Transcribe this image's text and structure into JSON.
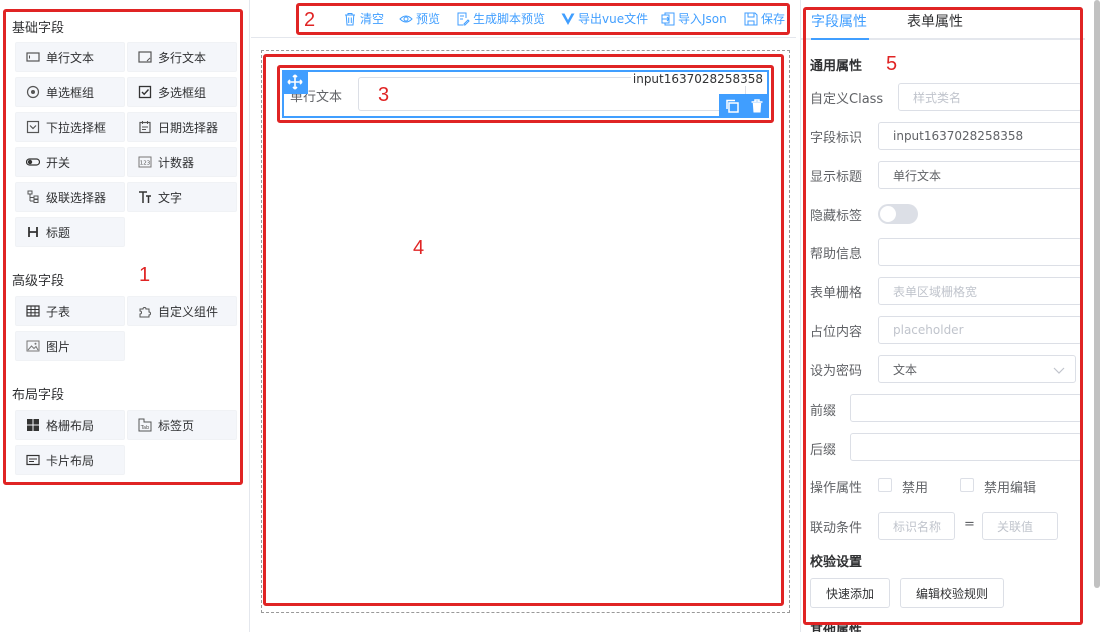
{
  "palette": {
    "basic_title": "基础字段",
    "basic_items": [
      {
        "label": "单行文本",
        "icon": "input-icon"
      },
      {
        "label": "多行文本",
        "icon": "textarea-icon"
      },
      {
        "label": "单选框组",
        "icon": "radio-icon"
      },
      {
        "label": "多选框组",
        "icon": "checkbox-icon"
      },
      {
        "label": "下拉选择框",
        "icon": "select-icon"
      },
      {
        "label": "日期选择器",
        "icon": "calendar-icon"
      },
      {
        "label": "开关",
        "icon": "switch-icon"
      },
      {
        "label": "计数器",
        "icon": "counter-icon"
      },
      {
        "label": "级联选择器",
        "icon": "cascader-icon"
      },
      {
        "label": "文字",
        "icon": "text-icon"
      },
      {
        "label": "标题",
        "icon": "heading-icon"
      }
    ],
    "advanced_title": "高级字段",
    "advanced_items": [
      {
        "label": "子表",
        "icon": "table-icon"
      },
      {
        "label": "自定义组件",
        "icon": "puzzle-icon"
      },
      {
        "label": "图片",
        "icon": "image-icon"
      }
    ],
    "layout_title": "布局字段",
    "layout_items": [
      {
        "label": "格栅布局",
        "icon": "grid-icon"
      },
      {
        "label": "标签页",
        "icon": "tabs-icon"
      },
      {
        "label": "卡片布局",
        "icon": "card-icon"
      }
    ]
  },
  "toolbar": {
    "clear": "清空",
    "preview": "预览",
    "script_preview": "生成脚本预览",
    "export_vue": "导出vue文件",
    "import_json": "导入Json",
    "save": "保存"
  },
  "canvas": {
    "field_label": "单行文本",
    "field_id": "input1637028258358"
  },
  "panel": {
    "tab_field": "字段属性",
    "tab_form": "表单属性",
    "common_title": "通用属性",
    "custom_class_label": "自定义Class",
    "custom_class_placeholder": "样式类名",
    "field_id_label": "字段标识",
    "field_id_value": "input1637028258358",
    "display_title_label": "显示标题",
    "display_title_value": "单行文本",
    "hide_label_label": "隐藏标签",
    "help_label": "帮助信息",
    "grid_label": "表单栅格",
    "grid_placeholder": "表单区域栅格宽",
    "placeholder_label": "占位内容",
    "placeholder_placeholder": "placeholder",
    "password_label": "设为密码",
    "password_value": "文本",
    "prefix_label": "前缀",
    "suffix_label": "后缀",
    "ops_label": "操作属性",
    "disable_label": "禁用",
    "disable_edit_label": "禁用编辑",
    "link_label": "联动条件",
    "link_key_placeholder": "标识名称",
    "link_eq": "=",
    "link_val_placeholder": "关联值",
    "validate_title": "校验设置",
    "quick_add": "快速添加",
    "edit_rules": "编辑校验规则",
    "other_title": "其他属性"
  },
  "annotations": [
    "1",
    "2",
    "3",
    "4",
    "5"
  ],
  "colors": {
    "accent": "#409eff",
    "annotation": "#e02424"
  }
}
